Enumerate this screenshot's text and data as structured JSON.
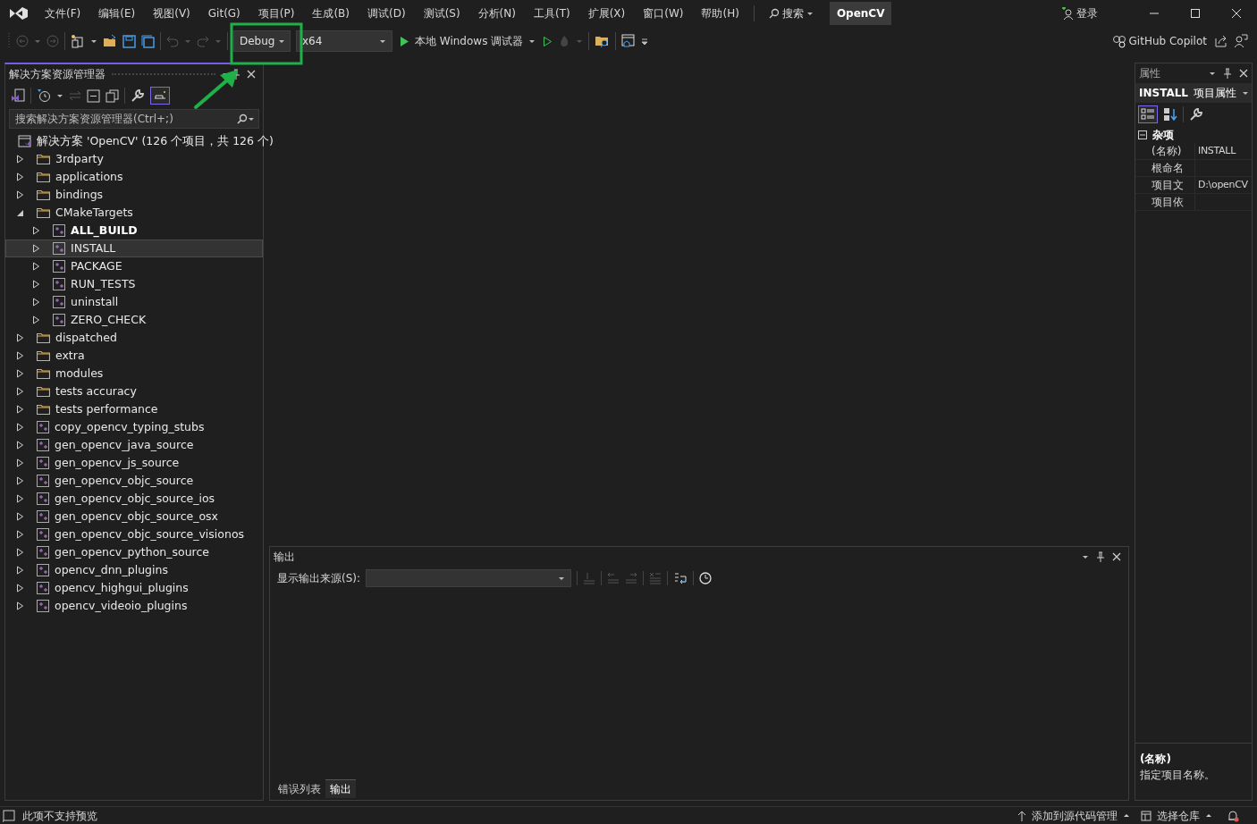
{
  "menu": [
    "文件(F)",
    "编辑(E)",
    "视图(V)",
    "Git(G)",
    "项目(P)",
    "生成(B)",
    "调试(D)",
    "测试(S)",
    "分析(N)",
    "工具(T)",
    "扩展(X)",
    "窗口(W)",
    "帮助(H)"
  ],
  "search": {
    "label": "搜索"
  },
  "solution_name": "OpenCV",
  "sign_in": "登录",
  "toolbar": {
    "configuration": "Debug",
    "platform": "x64",
    "run_target": "本地 Windows 调试器",
    "copilot": "GitHub Copilot"
  },
  "solution_explorer": {
    "title": "解决方案资源管理器",
    "search": {
      "placeholder": "搜索解决方案资源管理器(Ctrl+;)"
    },
    "solution": "解决方案 'OpenCV' (126 个项目，共 126 个)",
    "tree": [
      {
        "label": "3rdparty",
        "kind": "folder",
        "expanded": false,
        "selected": false,
        "startup": false
      },
      {
        "label": "applications",
        "kind": "folder",
        "expanded": false,
        "selected": false,
        "startup": false
      },
      {
        "label": "bindings",
        "kind": "folder",
        "expanded": false,
        "selected": false,
        "startup": false
      },
      {
        "label": "CMakeTargets",
        "kind": "folder",
        "expanded": true,
        "selected": false,
        "startup": false,
        "children": [
          {
            "label": "ALL_BUILD",
            "kind": "project",
            "expanded": false,
            "selected": false,
            "startup": true
          },
          {
            "label": "INSTALL",
            "kind": "project",
            "expanded": false,
            "selected": true,
            "startup": false
          },
          {
            "label": "PACKAGE",
            "kind": "project",
            "expanded": false,
            "selected": false,
            "startup": false
          },
          {
            "label": "RUN_TESTS",
            "kind": "project",
            "expanded": false,
            "selected": false,
            "startup": false
          },
          {
            "label": "uninstall",
            "kind": "project",
            "expanded": false,
            "selected": false,
            "startup": false
          },
          {
            "label": "ZERO_CHECK",
            "kind": "project",
            "expanded": false,
            "selected": false,
            "startup": false
          }
        ]
      },
      {
        "label": "dispatched",
        "kind": "folder",
        "expanded": false,
        "selected": false,
        "startup": false
      },
      {
        "label": "extra",
        "kind": "folder",
        "expanded": false,
        "selected": false,
        "startup": false
      },
      {
        "label": "modules",
        "kind": "folder",
        "expanded": false,
        "selected": false,
        "startup": false
      },
      {
        "label": "tests accuracy",
        "kind": "folder",
        "expanded": false,
        "selected": false,
        "startup": false
      },
      {
        "label": "tests performance",
        "kind": "folder",
        "expanded": false,
        "selected": false,
        "startup": false
      },
      {
        "label": "copy_opencv_typing_stubs",
        "kind": "project",
        "expanded": false,
        "selected": false,
        "startup": false
      },
      {
        "label": "gen_opencv_java_source",
        "kind": "project",
        "expanded": false,
        "selected": false,
        "startup": false
      },
      {
        "label": "gen_opencv_js_source",
        "kind": "project",
        "expanded": false,
        "selected": false,
        "startup": false
      },
      {
        "label": "gen_opencv_objc_source",
        "kind": "project",
        "expanded": false,
        "selected": false,
        "startup": false
      },
      {
        "label": "gen_opencv_objc_source_ios",
        "kind": "project",
        "expanded": false,
        "selected": false,
        "startup": false
      },
      {
        "label": "gen_opencv_objc_source_osx",
        "kind": "project",
        "expanded": false,
        "selected": false,
        "startup": false
      },
      {
        "label": "gen_opencv_objc_source_visionos",
        "kind": "project",
        "expanded": false,
        "selected": false,
        "startup": false
      },
      {
        "label": "gen_opencv_python_source",
        "kind": "project",
        "expanded": false,
        "selected": false,
        "startup": false
      },
      {
        "label": "opencv_dnn_plugins",
        "kind": "project",
        "expanded": false,
        "selected": false,
        "startup": false
      },
      {
        "label": "opencv_highgui_plugins",
        "kind": "project",
        "expanded": false,
        "selected": false,
        "startup": false
      },
      {
        "label": "opencv_videoio_plugins",
        "kind": "project",
        "expanded": false,
        "selected": false,
        "startup": false
      }
    ]
  },
  "output": {
    "title": "输出",
    "source_label": "显示输出来源(S):",
    "tabs": [
      {
        "label": "错误列表",
        "selected": false
      },
      {
        "label": "输出",
        "selected": true
      }
    ]
  },
  "properties": {
    "title": "属性",
    "object": "INSTALL",
    "object_type": "项目属性",
    "category": "杂项",
    "category_expanded": true,
    "rows": [
      {
        "name": "(名称)",
        "value": "INSTALL"
      },
      {
        "name": "根命名"
      },
      {
        "name": "项目文",
        "value": "D:\\openCV"
      },
      {
        "name": "项目依"
      }
    ],
    "description_title": "(名称)",
    "description": "指定项目名称。"
  },
  "status_bar": {
    "message": "此项不支持预览",
    "source_control": "添加到源代码管理",
    "repository": "选择仓库"
  },
  "annotation": {
    "highlight_box": true,
    "arrow": true
  }
}
